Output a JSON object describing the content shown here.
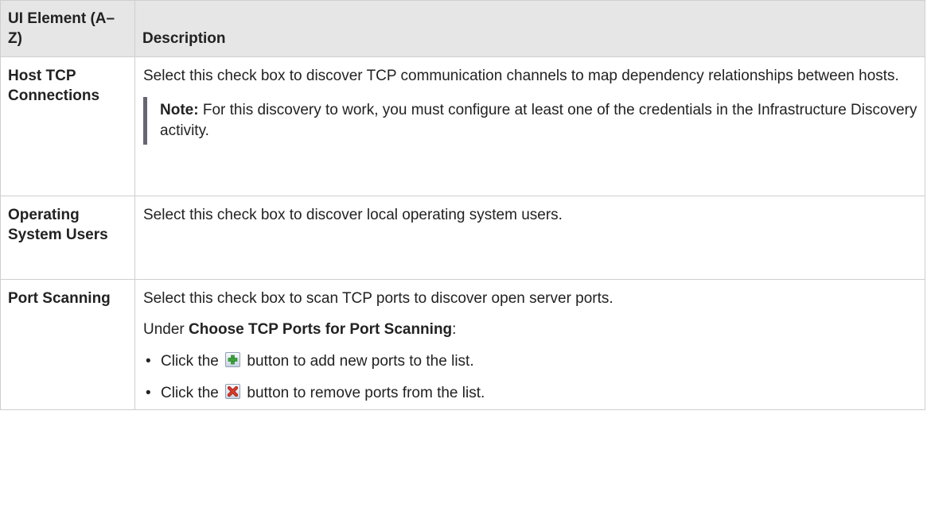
{
  "table": {
    "headers": {
      "ui_element": "UI Element (A–Z)",
      "description": "Description"
    },
    "rows": [
      {
        "name": "Host TCP Connections",
        "description": "Select this check box to discover TCP communication channels to map dependency relationships between hosts.",
        "note_label": "Note:",
        "note_text": "For this discovery to work, you must configure at least one of the credentials in the Infrastructure Discovery activity."
      },
      {
        "name": "Operating System Users",
        "description": "Select this check box to discover local operating system users."
      },
      {
        "name": "Port Scanning",
        "description": "Select this check box to scan TCP ports to discover open server ports.",
        "under_prefix": "Under",
        "under_bold": "Choose TCP Ports for Port Scanning",
        "under_suffix": ":",
        "bullets": [
          {
            "before": "Click the",
            "icon": "add-green-plus-icon",
            "after": "button to add new ports to the list."
          },
          {
            "before": "Click the",
            "icon": "remove-red-x-icon",
            "after": "button to remove ports from the list."
          }
        ]
      }
    ]
  },
  "colors": {
    "header_bg": "#e6e6e6",
    "border": "#cfcfcf",
    "note_bar": "#666673",
    "add_icon": "#3aa43a",
    "remove_icon": "#d83a2a"
  }
}
